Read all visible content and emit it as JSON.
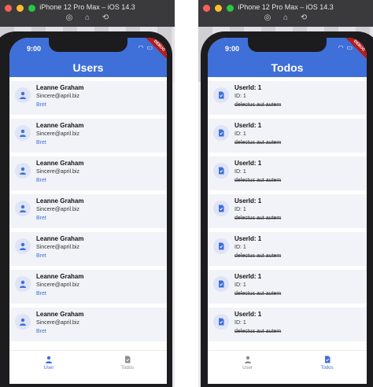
{
  "left_sim": {
    "sim_title": "iPhone 12 Pro Max – iOS 14.3",
    "status_time": "9:00",
    "debug_banner": "DEBUG",
    "appbar_title": "Users",
    "users": [
      {
        "name": "Leanne Graham",
        "email": "Sincere@april.biz",
        "username": "Bret"
      },
      {
        "name": "Leanne Graham",
        "email": "Sincere@april.biz",
        "username": "Bret"
      },
      {
        "name": "Leanne Graham",
        "email": "Sincere@april.biz",
        "username": "Bret"
      },
      {
        "name": "Leanne Graham",
        "email": "Sincere@april.biz",
        "username": "Bret"
      },
      {
        "name": "Leanne Graham",
        "email": "Sincere@april.biz",
        "username": "Bret"
      },
      {
        "name": "Leanne Graham",
        "email": "Sincere@april.biz",
        "username": "Bret"
      },
      {
        "name": "Leanne Graham",
        "email": "Sincere@april.biz",
        "username": "Bret"
      }
    ],
    "tabs": [
      {
        "label": "User",
        "icon": "person-icon",
        "active": true
      },
      {
        "label": "Todos",
        "icon": "task-icon",
        "active": false
      }
    ]
  },
  "right_sim": {
    "sim_title": "iPhone 12 Pro Max – iOS 14.3",
    "status_time": "9:00",
    "debug_banner": "DEBUG",
    "appbar_title": "Todos",
    "todos": [
      {
        "user_id": "UserId: 1",
        "id": "ID: 1",
        "title": "delectus aut autem"
      },
      {
        "user_id": "UserId: 1",
        "id": "ID: 1",
        "title": "delectus aut autem"
      },
      {
        "user_id": "UserId: 1",
        "id": "ID: 1",
        "title": "delectus aut autem"
      },
      {
        "user_id": "UserId: 1",
        "id": "ID: 1",
        "title": "delectus aut autem"
      },
      {
        "user_id": "UserId: 1",
        "id": "ID: 1",
        "title": "delectus aut autem"
      },
      {
        "user_id": "UserId: 1",
        "id": "ID: 1",
        "title": "delectus aut autem"
      },
      {
        "user_id": "UserId: 1",
        "id": "ID: 1",
        "title": "delectus aut autem"
      }
    ],
    "tabs": [
      {
        "label": "User",
        "icon": "person-icon",
        "active": false
      },
      {
        "label": "Todos",
        "icon": "task-icon",
        "active": true
      }
    ]
  },
  "colors": {
    "accent": "#3f6fd8",
    "item_bg": "#f2f3f8",
    "avatar_bg": "#dfe4f6"
  }
}
